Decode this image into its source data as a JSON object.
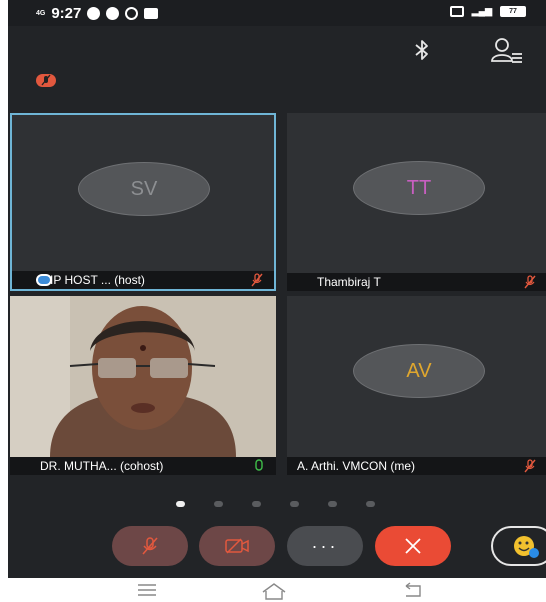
{
  "status_bar": {
    "network": "4G",
    "time": "9:27",
    "battery": "77"
  },
  "participants": [
    {
      "initials": "SV",
      "name": "SIP HOST ... (host)",
      "initials_color": "#8d8f92",
      "muted": true
    },
    {
      "initials": "TT",
      "name": "Thambiraj T",
      "initials_color": "#c75fc0",
      "muted": true
    },
    {
      "initials": "",
      "name": "DR. MUTHA... (cohost)",
      "muted": false,
      "video": true
    },
    {
      "initials": "AV",
      "name": "A. Arthi. VMCON (me)",
      "initials_color": "#e0a72e",
      "muted": true
    }
  ],
  "pager": {
    "count": 6,
    "active": 0
  },
  "controls": {
    "more_label": "···"
  },
  "colors": {
    "background": "#222427",
    "mute_red": "#e2583e",
    "end_call": "#ea4b35",
    "active_border": "#6fb5d6",
    "unmuted_green": "#3fbf4a"
  },
  "icons": [
    "bluetooth-icon",
    "participants-icon",
    "mic-muted-icon",
    "camera-off-icon",
    "end-call-icon",
    "emoji-reaction-icon",
    "nav-menu-icon",
    "nav-home-icon",
    "nav-back-icon"
  ]
}
